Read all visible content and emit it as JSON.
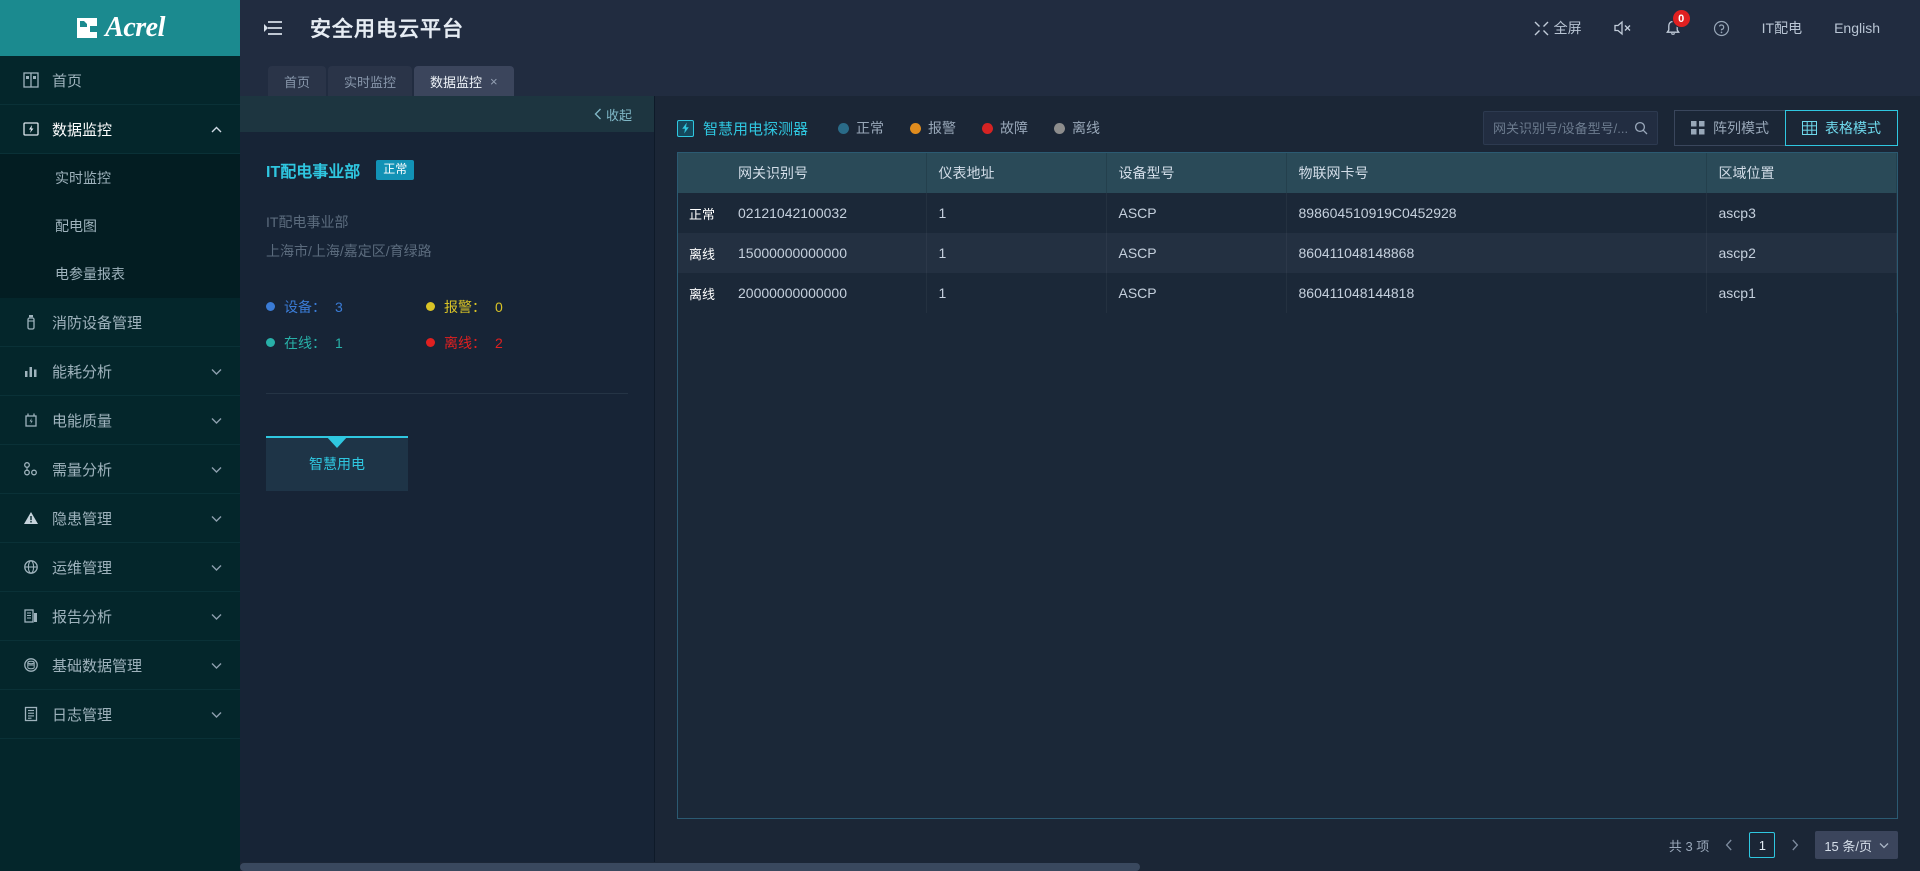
{
  "brand": {
    "name": "Acrel",
    "logo_icon": "acrel-logo-icon"
  },
  "sidebar": {
    "items": [
      {
        "label": "首页",
        "icon": "home-grid-icon",
        "expandable": false,
        "active": false
      },
      {
        "label": "数据监控",
        "icon": "monitor-bolt-icon",
        "expandable": true,
        "expanded": true,
        "active": true,
        "children": [
          {
            "label": "实时监控",
            "active": false
          },
          {
            "label": "配电图",
            "active": false
          },
          {
            "label": "电参量报表",
            "active": false
          }
        ]
      },
      {
        "label": "消防设备管理",
        "icon": "fire-extinguisher-icon",
        "expandable": false,
        "active": false
      },
      {
        "label": "能耗分析",
        "icon": "bar-chart-icon",
        "expandable": true,
        "active": false
      },
      {
        "label": "电能质量",
        "icon": "battery-icon",
        "expandable": true,
        "active": false
      },
      {
        "label": "需量分析",
        "icon": "nodes-icon",
        "expandable": true,
        "active": false
      },
      {
        "label": "隐患管理",
        "icon": "warning-triangle-icon",
        "expandable": true,
        "active": false
      },
      {
        "label": "运维管理",
        "icon": "globe-gear-icon",
        "expandable": true,
        "active": false
      },
      {
        "label": "报告分析",
        "icon": "report-icon",
        "expandable": true,
        "active": false
      },
      {
        "label": "基础数据管理",
        "icon": "database-circle-icon",
        "expandable": true,
        "active": false
      },
      {
        "label": "日志管理",
        "icon": "log-list-icon",
        "expandable": true,
        "active": false
      }
    ]
  },
  "header": {
    "menu_toggle_icon": "hamburger-collapse-icon",
    "title": "安全用电云平台",
    "actions": [
      {
        "label": "全屏",
        "icon": "fullscreen-icon"
      },
      {
        "label": "",
        "icon": "sound-muted-icon"
      },
      {
        "label": "",
        "icon": "bell-icon",
        "badge": "0"
      },
      {
        "label": "",
        "icon": "help-circle-icon"
      },
      {
        "label": "IT配电",
        "icon": "user-account-icon"
      },
      {
        "label": "English",
        "icon": "language-icon"
      }
    ]
  },
  "tabs": [
    {
      "label": "首页",
      "active": false,
      "closable": false
    },
    {
      "label": "实时监控",
      "active": false,
      "closable": false
    },
    {
      "label": "数据监控",
      "active": true,
      "closable": true,
      "close_label": "×"
    }
  ],
  "left_panel": {
    "collapse_label": "收起",
    "collapse_icon": "chevron-left-icon",
    "org_name": "IT配电事业部",
    "org_status": "正常",
    "org_detail": "IT配电事业部",
    "org_address": "上海市/上海/嘉定区/育绿路",
    "stats": [
      {
        "label": "设备：",
        "value": "3",
        "color": "#3a7bd5",
        "text_color": "#3a7bd5"
      },
      {
        "label": "报警：",
        "value": "0",
        "color": "#d9c326",
        "text_color": "#d9c326"
      },
      {
        "label": "在线：",
        "value": "1",
        "color": "#28b0a8",
        "text_color": "#28b0a8"
      },
      {
        "label": "离线：",
        "value": "2",
        "color": "#e02020",
        "text_color": "#e02020"
      }
    ],
    "tree_node": "智慧用电"
  },
  "toolbar": {
    "device_type": "智慧用电探测器",
    "device_type_icon": "bolt-box-icon",
    "legend": [
      {
        "label": "正常",
        "color": "#2a6b88"
      },
      {
        "label": "报警",
        "color": "#e08c1e"
      },
      {
        "label": "故障",
        "color": "#d62323"
      },
      {
        "label": "离线",
        "color": "#8d8d8d"
      }
    ],
    "search_placeholder": "网关识别号/设备型号/...",
    "search_value": "",
    "search_icon": "search-icon",
    "modes": [
      {
        "label": "阵列模式",
        "icon": "grid-mode-icon",
        "active": false
      },
      {
        "label": "表格模式",
        "icon": "table-mode-icon",
        "active": true
      }
    ]
  },
  "table": {
    "columns": [
      {
        "key": "status",
        "label": ""
      },
      {
        "key": "gateway_id",
        "label": "网关识别号"
      },
      {
        "key": "meter_addr",
        "label": "仪表地址"
      },
      {
        "key": "device_model",
        "label": "设备型号"
      },
      {
        "key": "iot_card",
        "label": "物联网卡号"
      },
      {
        "key": "area",
        "label": "区域位置"
      }
    ],
    "rows": [
      {
        "status": "正常",
        "status_kind": "normal",
        "gateway_id": "02121042100032",
        "meter_addr": "1",
        "device_model": "ASCP",
        "iot_card": "898604510919C0452928",
        "area": "ascp3"
      },
      {
        "status": "离线",
        "status_kind": "offline",
        "gateway_id": "15000000000000",
        "meter_addr": "1",
        "device_model": "ASCP",
        "iot_card": "860411048148868",
        "area": "ascp2"
      },
      {
        "status": "离线",
        "status_kind": "offline",
        "gateway_id": "20000000000000",
        "meter_addr": "1",
        "device_model": "ASCP",
        "iot_card": "860411048144818",
        "area": "ascp1"
      }
    ]
  },
  "pagination": {
    "total_label": "共 3 项",
    "prev_icon": "chevron-left-icon",
    "next_icon": "chevron-right-icon",
    "current_page": "1",
    "page_size": "15 条/页",
    "page_size_icon": "chevron-down-icon"
  },
  "colors": {
    "brand_teal": "#1b8a8f",
    "accent_cyan": "#2fc7e0",
    "sidebar_bg": "#04262b",
    "header_bg": "#212c40",
    "page_bg": "#1b2636",
    "table_header_bg": "#2a4a58",
    "status_normal": "#15657f",
    "status_offline": "#8d8d8d",
    "badge_red": "#e02020"
  }
}
